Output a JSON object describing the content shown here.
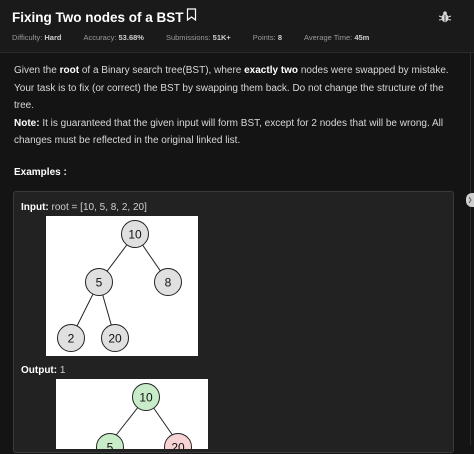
{
  "problem": {
    "title": "Fixing Two nodes of a BST",
    "meta": [
      {
        "label": "Difficulty:",
        "value": "Hard"
      },
      {
        "label": "Accuracy:",
        "value": "53.68%"
      },
      {
        "label": "Submissions:",
        "value": "51K+"
      },
      {
        "label": "Points:",
        "value": "8"
      },
      {
        "label": "Average Time:",
        "value": "45m"
      }
    ]
  },
  "description": {
    "p1_pre": "Given the ",
    "p1_b1": "root",
    "p1_mid": " of a Binary search tree(BST), where ",
    "p1_b2": "exactly two",
    "p1_post": " nodes were swapped by mistake. Your task is to fix (or correct) the BST by swapping them back. Do not change the structure of the tree.",
    "note_label": "Note:",
    "note_text": " It is guaranteed that the given input will form BST, except for 2 nodes that will be wrong. All changes must be reflected in the original linked list."
  },
  "examples_label": "Examples :",
  "example1": {
    "input_label": "Input:",
    "input_value": " root = [10, 5, 8, 2, 20]",
    "output_label": "Output:",
    "output_value": " 1",
    "input_tree": [
      "10",
      "5",
      "8",
      "2",
      "20"
    ],
    "output_tree": [
      "10",
      "5",
      "20"
    ]
  },
  "colors": {
    "node_default": "#e0e0e0",
    "node_green": "#c8ecc8",
    "node_red": "#f8d3d3"
  },
  "icons": [
    "bookmark-icon",
    "bug-icon"
  ]
}
